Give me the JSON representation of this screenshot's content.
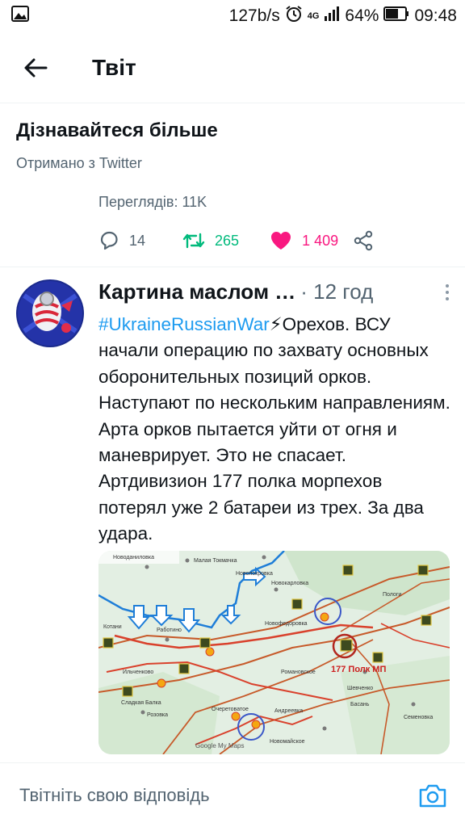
{
  "status_bar": {
    "network_speed": "127b/s",
    "network_type": "4G",
    "battery": "64%",
    "time": "09:48",
    "icons": [
      "image-icon",
      "alarm-icon",
      "signal-icon",
      "battery-icon"
    ]
  },
  "header": {
    "title": "Твіт",
    "back_icon": "arrow-left-icon"
  },
  "learn_more": {
    "title": "Дізнавайтеся більше",
    "source": "Отримано з Twitter"
  },
  "stats": {
    "views": "Переглядів: 11K",
    "replies": "14",
    "retweets": "265",
    "likes": "1 409"
  },
  "tweet": {
    "author": "Картина маслом …",
    "time": "· 12 год",
    "hashtag": "#UkraineRussianWar",
    "emoji": "⚡",
    "text": "Орехов. ВСУ начали операцию по захвату основных оборонительных позиций орков. Наступают по нескольким направлениям. Арта орков пытается уйти от огня и маневрирует. Это не спасает. Артдивизион 177 полка морпехов потерял уже 2 батареи из трех. За два удара.",
    "map": {
      "regiment_label": "177 Полк МП",
      "attribution": "Google My Maps",
      "place_names": [
        "Новоданиловка",
        "Малая Токмачка",
        "Новопокровка",
        "Новокарловка",
        "Котани",
        "Работино",
        "Новофедоровка",
        "Пологи",
        "Ильченково",
        "Сладкая Балка",
        "Розовка",
        "Романовское",
        "Шевченко",
        "Басань",
        "Андреевка",
        "Новомайское",
        "Очеретоватое",
        "Семеновка"
      ],
      "colors": {
        "front_blue": "#1f7ed8",
        "line_red": "#d9412c",
        "road_orange": "#c75a2a",
        "land": "#e3efe3",
        "label_red": "#cc1f1f"
      }
    }
  },
  "reply": {
    "placeholder": "Твітніть свою відповідь"
  },
  "colors": {
    "accent": "#1d9bf0",
    "retweet": "#00ba7c",
    "like": "#f91880",
    "secondary_text": "#536471"
  }
}
